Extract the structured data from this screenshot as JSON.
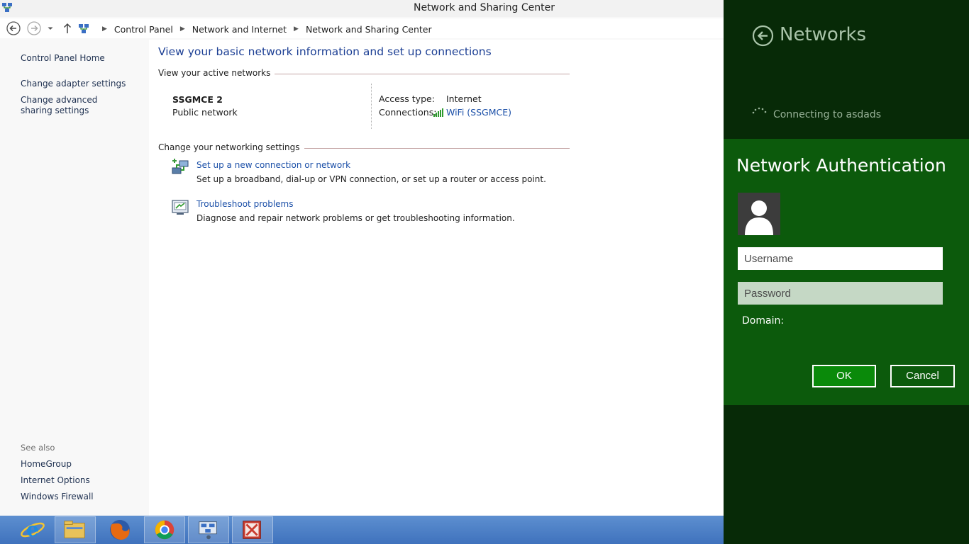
{
  "window": {
    "title": "Network and Sharing Center"
  },
  "breadcrumb": [
    "Control Panel",
    "Network and Internet",
    "Network and Sharing Center"
  ],
  "sidebar": {
    "home": "Control Panel Home",
    "items": [
      "Change adapter settings",
      "Change advanced sharing settings"
    ],
    "see_also_label": "See also",
    "see_also": [
      "HomeGroup",
      "Internet Options",
      "Windows Firewall"
    ]
  },
  "main": {
    "heading": "View your basic network information and set up connections",
    "active_networks_label": "View your active networks",
    "network": {
      "name": "SSGMCE  2",
      "type": "Public network",
      "access_type_label": "Access type:",
      "access_type_value": "Internet",
      "connections_label": "Connections:",
      "connections_value": "WiFi (SSGMCE)"
    },
    "change_settings_label": "Change your networking settings",
    "tasks": [
      {
        "link": "Set up a new connection or network",
        "desc": "Set up a broadband, dial-up or VPN connection, or set up a router or access point.",
        "icon": "network-setup-icon"
      },
      {
        "link": "Troubleshoot problems",
        "desc": "Diagnose and repair network problems or get troubleshooting information.",
        "icon": "troubleshoot-icon"
      }
    ]
  },
  "taskbar": {
    "items": [
      "internet-explorer-icon",
      "file-explorer-icon",
      "firefox-icon",
      "chrome-icon",
      "control-panel-icon",
      "presentation-app-icon"
    ]
  },
  "networks_panel": {
    "title": "Networks",
    "status": "Connecting to asdads",
    "auth": {
      "title": "Network Authentication",
      "username_placeholder": "Username",
      "password_placeholder": "Password",
      "domain_label": "Domain:",
      "ok": "OK",
      "cancel": "Cancel"
    }
  },
  "colors": {
    "link": "#1c50a8",
    "heading": "#1c3f94",
    "panel_bg": "#072a07",
    "auth_bg": "#0c5a0c",
    "ok_bg": "#0a8a0a",
    "taskbar": "#4a7dc4"
  }
}
